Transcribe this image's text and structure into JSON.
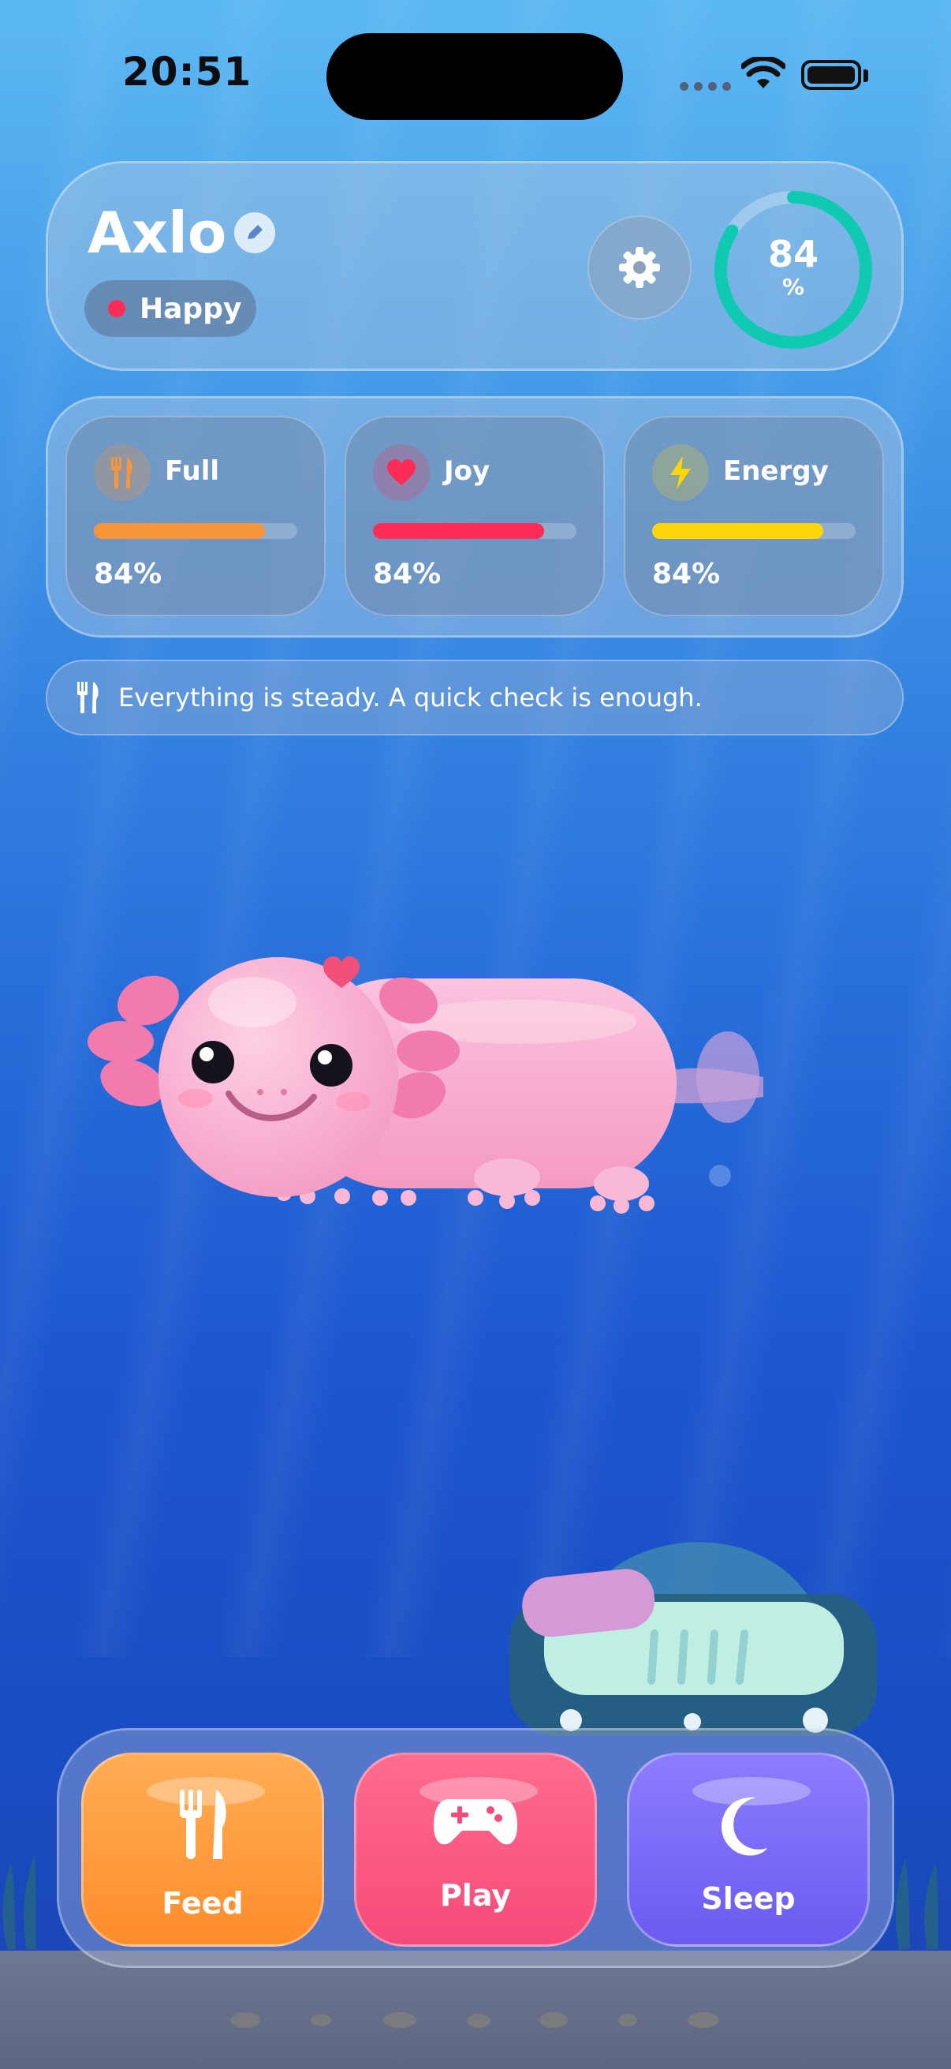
{
  "status_bar": {
    "time": "20:51"
  },
  "pet": {
    "name": "Axlo",
    "mood": "Happy",
    "overall": "84",
    "overall_unit": "%",
    "overall_fraction": 0.84
  },
  "stats": [
    {
      "label": "Full",
      "value": "84%",
      "fraction": 0.84,
      "color": "#f7953a",
      "icon": "fork-knife-icon"
    },
    {
      "label": "Joy",
      "value": "84%",
      "fraction": 0.84,
      "color": "#ff2d55",
      "icon": "heart-icon"
    },
    {
      "label": "Energy",
      "value": "84%",
      "fraction": 0.84,
      "color": "#ffd60a",
      "icon": "lightning-icon"
    }
  ],
  "tip": {
    "text": "Everything is steady. A quick check is enough.",
    "icon": "fork-knife-icon"
  },
  "actions": [
    {
      "label": "Feed",
      "icon": "fork-knife-icon",
      "color": "#ff9a3c"
    },
    {
      "label": "Play",
      "icon": "gamepad-icon",
      "color": "#f9577f"
    },
    {
      "label": "Sleep",
      "icon": "moon-icon",
      "color": "#7b6cf7"
    }
  ],
  "colors": {
    "ring": "#0fc9b0",
    "accent_pink": "#f7a8c8"
  }
}
